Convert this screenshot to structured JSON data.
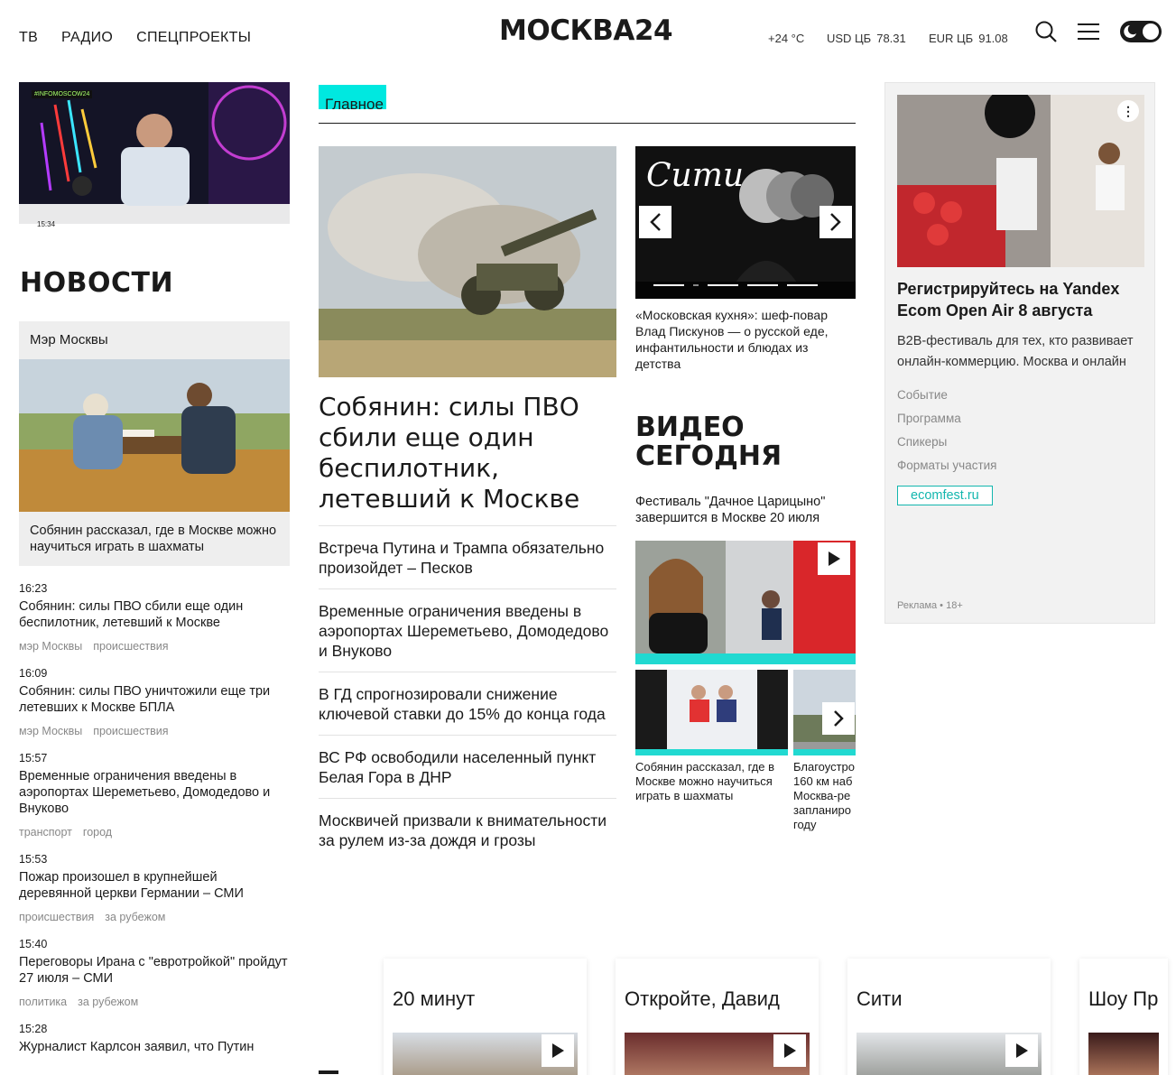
{
  "header": {
    "nav": [
      "ТВ",
      "РАДИО",
      "СПЕЦПРОЕКТЫ"
    ],
    "logo": "МОСКВА24",
    "weather": "+24 °C",
    "usd_label": "USD ЦБ",
    "usd_value": "78.31",
    "eur_label": "EUR ЦБ",
    "eur_value": "91.08"
  },
  "left": {
    "live_badge": "#INFOMOSCOW24",
    "live_time": "15:34",
    "section_title": "НОВОСТИ",
    "mayor_label": "Мэр Москвы",
    "mayor_caption": "Собянин рассказал, где в Москве можно научиться играть в шахматы",
    "feed": [
      {
        "time": "16:23",
        "headline": "Собянин: силы ПВО сбили еще один беспилотник, летевший к Москве",
        "tags": [
          "мэр Москвы",
          "происшествия"
        ]
      },
      {
        "time": "16:09",
        "headline": "Собянин: силы ПВО уничтожили еще три летевших к Москве БПЛА",
        "tags": [
          "мэр Москвы",
          "происшествия"
        ]
      },
      {
        "time": "15:57",
        "headline": "Временные ограничения введены в аэропортах Шереметьево, Домодедово и Внуково",
        "tags": [
          "транспорт",
          "город"
        ]
      },
      {
        "time": "15:53",
        "headline": "Пожар произошел в крупнейшей деревянной церкви Германии – СМИ",
        "tags": [
          "происшествия",
          "за рубежом"
        ]
      },
      {
        "time": "15:40",
        "headline": "Переговоры Ирана с \"евротройкой\" пройдут 27 июля – СМИ",
        "tags": [
          "политика",
          "за рубежом"
        ]
      },
      {
        "time": "15:28",
        "headline": "Журналист Карлсон заявил, что Путин",
        "tags": []
      }
    ]
  },
  "center": {
    "tab_label": "Главное",
    "hero_title": "Собянин: силы ПВО сбили еще один беспилотник, летевший к Москве",
    "list": [
      "Встреча Путина и Трампа обязательно произойдет – Песков",
      "Временные ограничения введены в аэропортах Шереметьево, Домодедово и Внуково",
      "В ГД спрогнозировали снижение ключевой ставки до 15% до конца года",
      "ВС РФ освободили населенный пункт Белая Гора в ДНР",
      "Москвичей призвали к внимательности за рулем из-за дождя и грозы"
    ],
    "slider_logo": "Сити",
    "slider_caption": "«Московская кухня»: шеф-повар Влад Пискунов — о русской еде, инфантильности и блюдах из детства",
    "video_title_1": "ВИДЕО",
    "video_title_2": "СЕГОДНЯ",
    "video_lead": "Фестиваль \"Дачное Царицыно\" завершится в Москве 20 июля",
    "video_small_1": "Собянин рассказал, где в Москве можно научиться играть в шахматы",
    "video_small_2": "Благоустро 160 км наб Москва-ре запланиро году"
  },
  "ad": {
    "title": "Регистрируйтесь на Yandex Ecom Open Air 8 августа",
    "desc": "B2B-фестиваль для тех, кто развивает онлайн-коммерцию. Москва и онлайн",
    "links": [
      "Событие",
      "Программа",
      "Спикеры",
      "Форматы участия"
    ],
    "button": "ecomfest.ru",
    "mark": "Реклама • 18+"
  },
  "shows": [
    "20 минут",
    "Откройте, Давид",
    "Сити",
    "Шоу Пр"
  ],
  "colors": {
    "accent": "#00e8e0",
    "ad_button": "#13b6ae"
  }
}
